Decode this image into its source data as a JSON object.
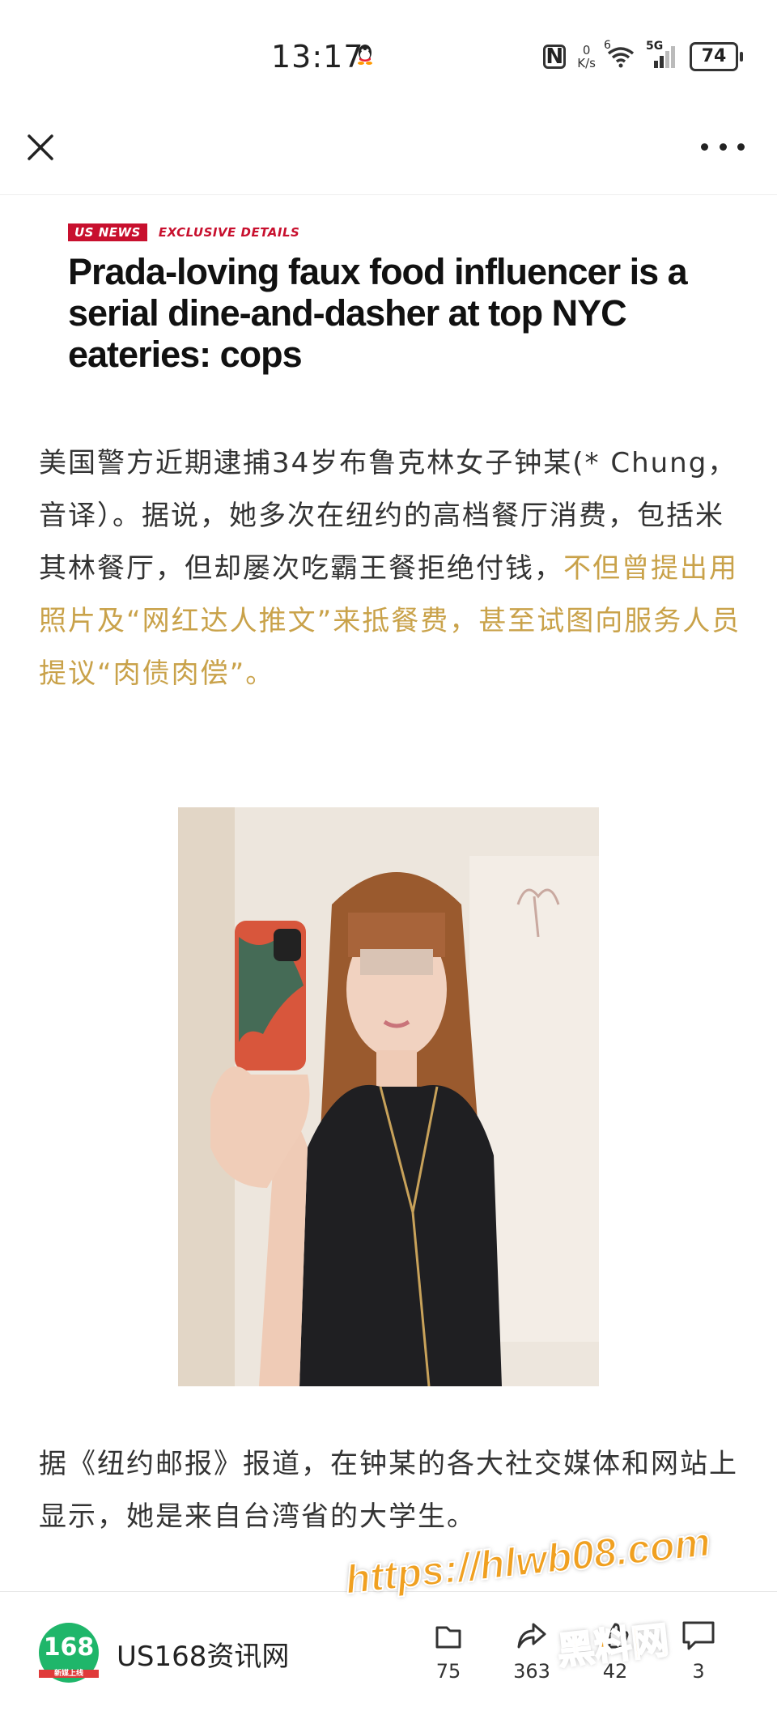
{
  "status_bar": {
    "time": "13:17",
    "nfc": "N",
    "net_speed_value": "0",
    "net_speed_unit": "K/s",
    "wifi_label": "6",
    "signal_label": "5G",
    "battery": "74"
  },
  "nav": {
    "close_icon": "close-icon",
    "more_icon": "more-icon"
  },
  "headline_image": {
    "tag_section": "US NEWS",
    "tag_type": "EXCLUSIVE DETAILS",
    "title": "Prada-loving faux food influencer is a serial dine-and-dasher at top NYC eateries: cops"
  },
  "article": {
    "para1_normal": "美国警方近期逮捕34岁布鲁克林女子钟某(* Chung，音译）。据说，她多次在纽约的高档餐厅消费，包括米其林餐厅，但却屡次吃霸王餐拒绝付钱，",
    "para1_highlight": "不但曾提出用照片及“网红达人推文”来抵餐费，甚至试图向服务人员提议“肉债肉偿”。",
    "para2": "据《纽约邮报》报道，在钟某的各大社交媒体和网站上显示，她是来自台湾省的大学生。"
  },
  "bottom_bar": {
    "logo_text": "168",
    "logo_sub": "新媒上线",
    "source_name": "US168资讯网",
    "actions": [
      {
        "icon": "collect-icon",
        "count": "75"
      },
      {
        "icon": "share-icon",
        "count": "363"
      },
      {
        "icon": "like-icon",
        "count": "42"
      },
      {
        "icon": "comment-icon",
        "count": "3"
      }
    ]
  },
  "watermark": {
    "url": "https://hlwb08.com",
    "name": "黑料网"
  },
  "colors": {
    "highlight": "#c9a24a",
    "brand_red": "#c8102e",
    "logo_green": "#1fb66a",
    "watermark": "#f0a020"
  }
}
